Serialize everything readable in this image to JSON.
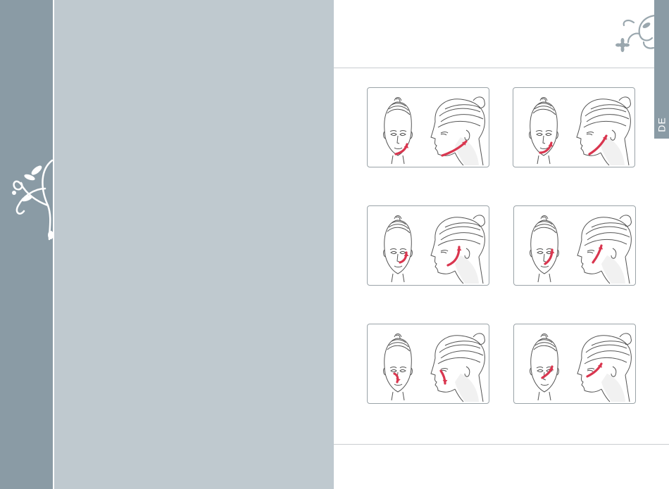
{
  "side_tab": {
    "label": "DE"
  },
  "colors": {
    "slate": "#8a9ba5",
    "panel": "#bfc9cf",
    "arrow": "#d9364f"
  },
  "illustrations": [
    {
      "name": "jawline-lift"
    },
    {
      "name": "lower-jaw-lift"
    },
    {
      "name": "cheek-lift"
    },
    {
      "name": "mid-cheek-lift"
    },
    {
      "name": "nose-side"
    },
    {
      "name": "upper-cheek-lift"
    }
  ]
}
